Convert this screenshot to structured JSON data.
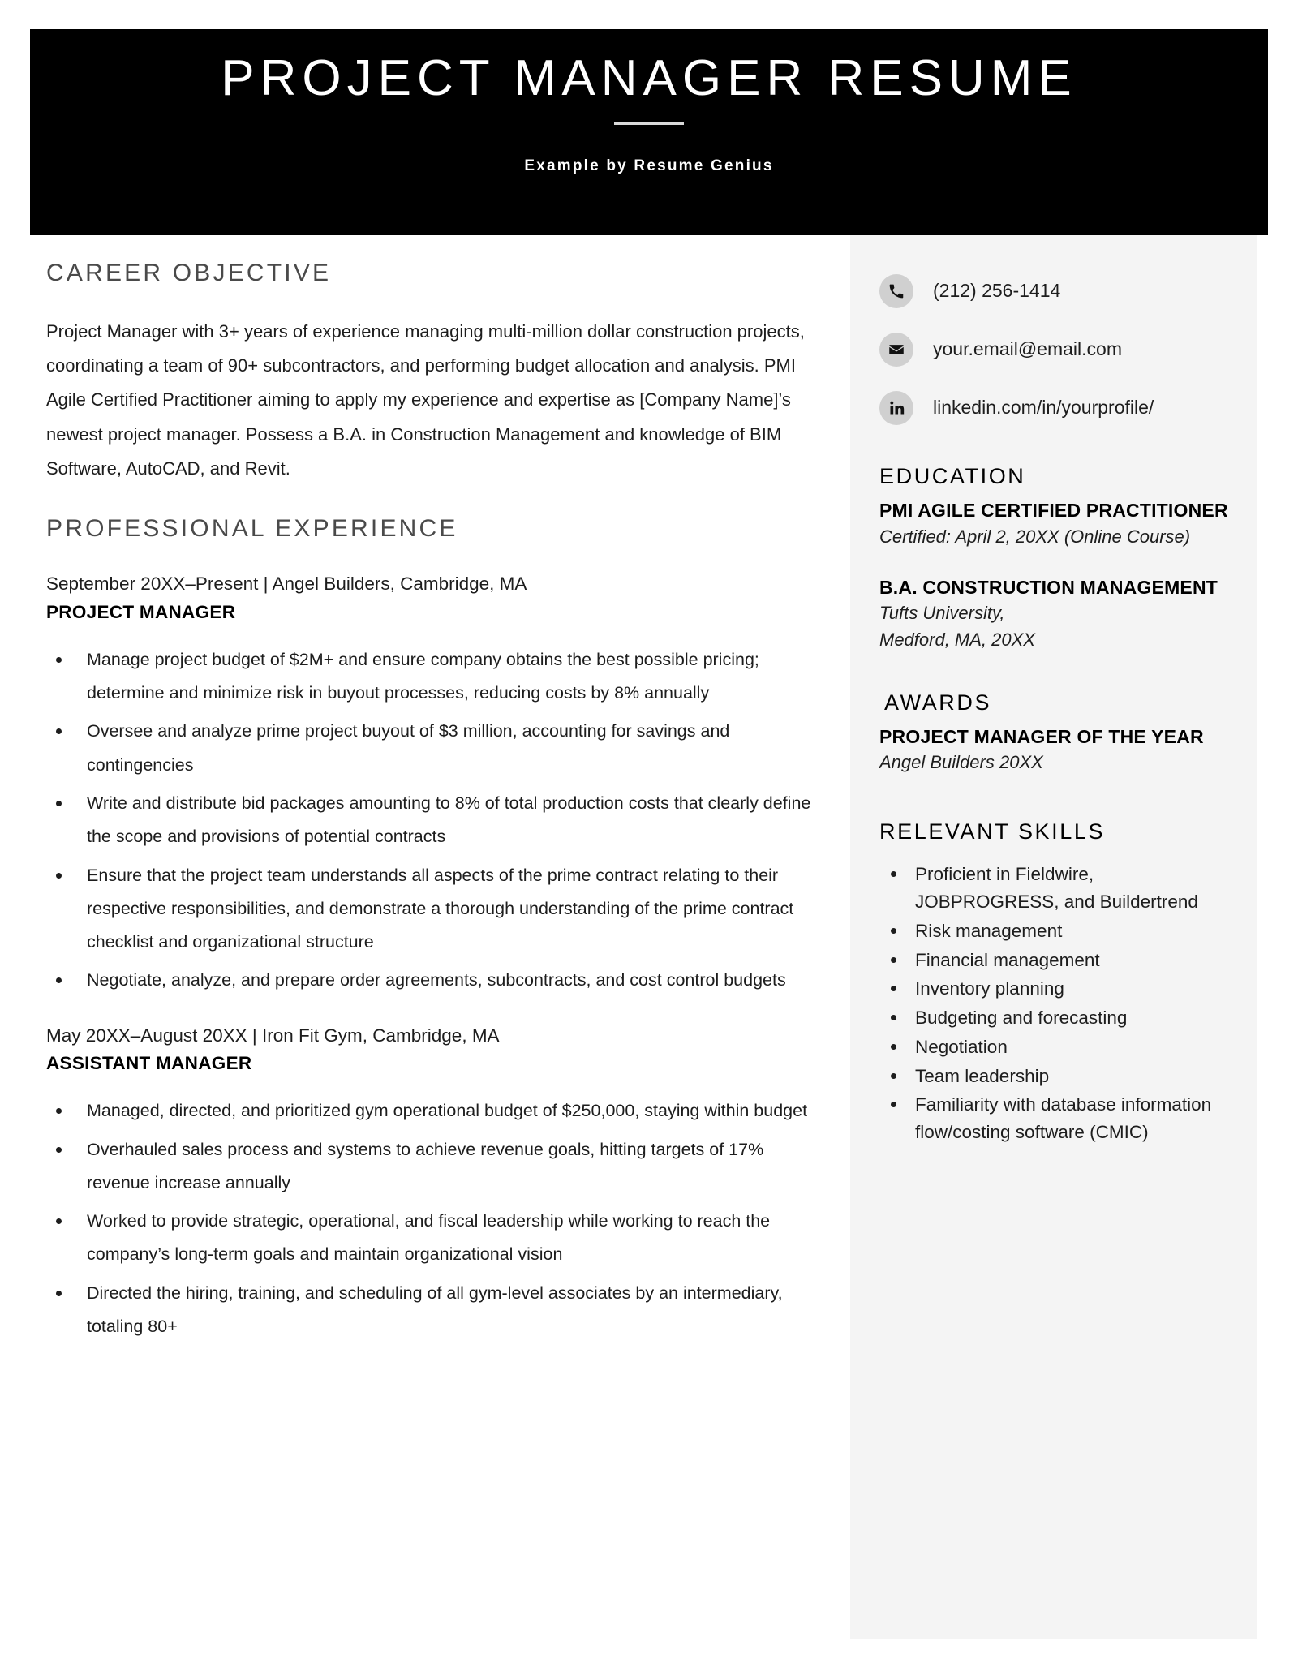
{
  "header": {
    "title": "PROJECT MANAGER RESUME",
    "subtitle": "Example by Resume Genius"
  },
  "main": {
    "objective": {
      "heading": "CAREER OBJECTIVE",
      "text": "Project Manager with 3+ years of experience managing multi-million dollar construction projects, coordinating a team of 90+ subcontractors, and performing budget allocation and analysis. PMI Agile Certified Practitioner aiming to apply my experience and expertise as [Company Name]’s newest project manager. Possess a B.A. in Construction Management and knowledge of BIM Software, AutoCAD, and Revit."
    },
    "experience": {
      "heading": "PROFESSIONAL EXPERIENCE",
      "jobs": [
        {
          "meta": "September 20XX–Present | Angel Builders, Cambridge, MA",
          "title": "PROJECT MANAGER",
          "bullets": [
            "Manage project budget of $2M+ and ensure company obtains the best possible pricing; determine and minimize risk in buyout processes, reducing costs by 8% annually",
            "Oversee and analyze prime project buyout of $3 million, accounting for savings and contingencies",
            "Write and distribute bid packages amounting to 8% of total production costs that clearly define the scope and provisions of potential contracts",
            "Ensure that the project team understands all aspects of the prime contract relating to their respective responsibilities, and demonstrate a thorough understanding of the prime contract checklist and organizational structure",
            "Negotiate, analyze, and prepare order agreements, subcontracts, and cost control budgets"
          ]
        },
        {
          "meta": "May 20XX–August 20XX | Iron Fit Gym, Cambridge, MA",
          "title": "ASSISTANT MANAGER",
          "bullets": [
            "Managed, directed, and prioritized gym operational budget of $250,000, staying within budget",
            "Overhauled sales process and systems to achieve revenue goals, hitting targets of 17% revenue increase annually",
            "Worked to provide strategic, operational, and fiscal leadership while working to reach the company’s long-term goals and maintain organizational vision",
            "Directed the hiring, training, and scheduling of all gym-level associates by an intermediary, totaling 80+"
          ]
        }
      ]
    }
  },
  "sidebar": {
    "contact": [
      {
        "icon": "phone-icon",
        "text": "(212) 256-1414"
      },
      {
        "icon": "email-icon",
        "text": "your.email@email.com"
      },
      {
        "icon": "linkedin-icon",
        "text": "linkedin.com/in/yourprofile/"
      }
    ],
    "education": {
      "heading": "EDUCATION",
      "entries": [
        {
          "title": "PMI AGILE CERTIFIED PRACTITIONER",
          "sub": "Certified: April 2, 20XX (Online Course)"
        },
        {
          "title": "B.A. CONSTRUCTION MANAGEMENT",
          "sub_line1": "Tufts University,",
          "sub_line2": "Medford, MA, 20XX"
        }
      ]
    },
    "awards": {
      "heading": "AWARDS",
      "title": "PROJECT MANAGER OF THE YEAR",
      "sub": "Angel Builders 20XX"
    },
    "skills": {
      "heading": "RELEVANT SKILLS",
      "items": [
        "Proficient in Fieldwire, JOBPROGRESS, and Buildertrend",
        "Risk management",
        "Financial management",
        "Inventory planning",
        "Budgeting and forecasting",
        "Negotiation",
        "Team leadership",
        "Familiarity with database information flow/costing software (CMIC)"
      ]
    }
  },
  "colors": {
    "header_bg": "#000000",
    "sidebar_bg": "#f4f4f4",
    "icon_bg": "#d0d0d0",
    "heading_gray": "#4a4a4a",
    "body_text": "#1d1d1d"
  }
}
